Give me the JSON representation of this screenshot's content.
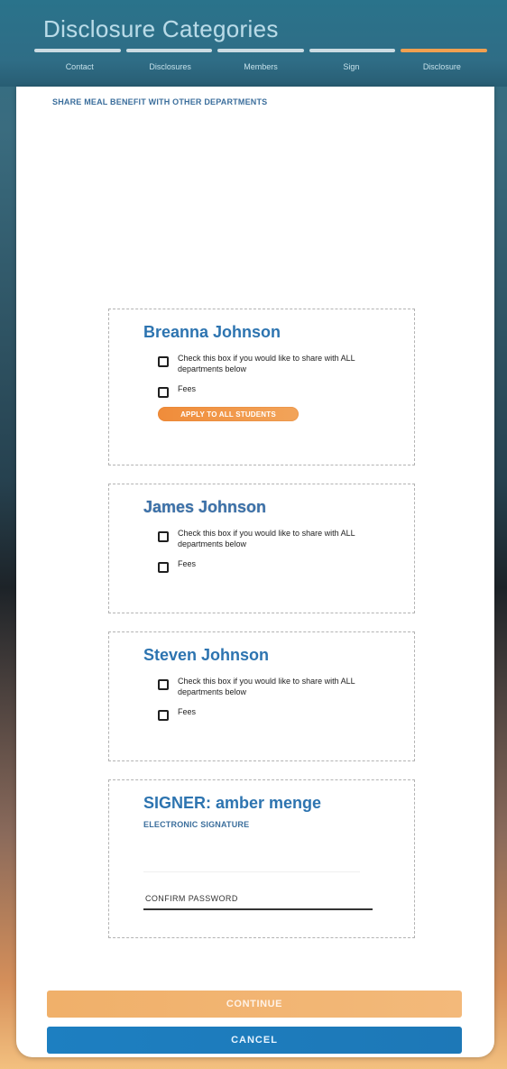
{
  "header": {
    "title": "Disclosure Categories",
    "steps": [
      {
        "label": "Contact",
        "active": false
      },
      {
        "label": "Disclosures",
        "active": false
      },
      {
        "label": "Members",
        "active": false
      },
      {
        "label": "Sign",
        "active": false
      },
      {
        "label": "Disclosure",
        "active": true
      }
    ],
    "accent_color": "#f0a050"
  },
  "sheet": {
    "section_title": "SHARE MEAL BENEFIT WITH OTHER DEPARTMENTS"
  },
  "members": [
    {
      "name": "Breanna Johnson",
      "share_all_text": "Check this box if you would like to share with ALL departments below",
      "fees_label": "Fees",
      "apply_button_label": "APPLY TO ALL STUDENTS"
    },
    {
      "name": "James Johnson",
      "share_all_text": "Check this box if you would like to share with ALL departments below",
      "fees_label": "Fees"
    },
    {
      "name": "Steven Johnson",
      "share_all_text": "Check this box if you would like to share with ALL departments below",
      "fees_label": "Fees"
    }
  ],
  "signer": {
    "title": "SIGNER: amber menge",
    "subtitle": "ELECTRONIC SIGNATURE",
    "password_label": "CONFIRM PASSWORD"
  },
  "actions": {
    "continue_label": "CONTINUE",
    "cancel_label": "CANCEL"
  }
}
